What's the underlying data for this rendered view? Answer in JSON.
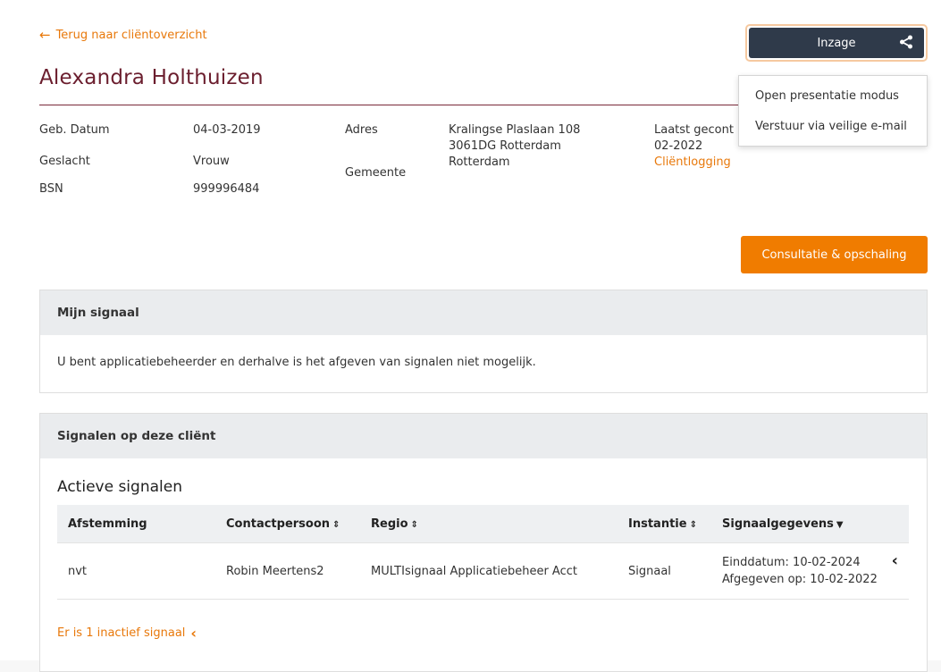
{
  "back_link": {
    "arrow": "←",
    "label": "Terug naar cliëntoverzicht"
  },
  "client": {
    "name": "Alexandra Holthuizen"
  },
  "inzage": {
    "label": "Inzage"
  },
  "dropdown": {
    "items": [
      "Open presentatie modus",
      "Verstuur via veilige e-mail"
    ]
  },
  "info": {
    "dob_label": "Geb. Datum",
    "dob_value": "04-03-2019",
    "gender_label": "Geslacht",
    "gender_value": "Vrouw",
    "bsn_label": "BSN",
    "bsn_value": "999996484",
    "address_label": "Adres",
    "address_line1": "Kralingse Plaslaan 108",
    "address_line2": "3061DG Rotterdam",
    "municipality_label": "Gemeente",
    "municipality_value": "Rotterdam",
    "last_consulted_label": "Laatst gecont",
    "last_consulted_value": "02-2022",
    "client_logging_link": "Cliëntlogging"
  },
  "consult_button": "Consultatie & opschaling",
  "my_signal": {
    "header": "Mijn signaal",
    "message": "U bent applicatiebeheerder en derhalve is het afgeven van signalen niet mogelijk."
  },
  "signals": {
    "header": "Signalen op deze cliënt",
    "active_title": "Actieve signalen",
    "columns": {
      "afstemming": "Afstemming",
      "contact": "Contactpersoon",
      "regio": "Regio",
      "instantie": "Instantie",
      "signaal": "Signaalgegevens"
    },
    "sort_icon": "⇕",
    "sort_desc_icon": "▼",
    "row": {
      "afstemming": "nvt",
      "contact": "Robin Meertens2",
      "regio": "MULTIsignaal Applicatiebeheer Acct",
      "instantie": "Signaal",
      "einddatum": "Einddatum: 10-02-2024",
      "afgegeven": "Afgegeven op: 10-02-2022",
      "expand_icon": "‹"
    },
    "inactive_link": "Er is 1 inactief signaal",
    "inactive_icon": "‹"
  },
  "colors": {
    "accent": "#f07c00",
    "brand": "#6b1e2e",
    "dark_button": "#2f3a4a"
  }
}
